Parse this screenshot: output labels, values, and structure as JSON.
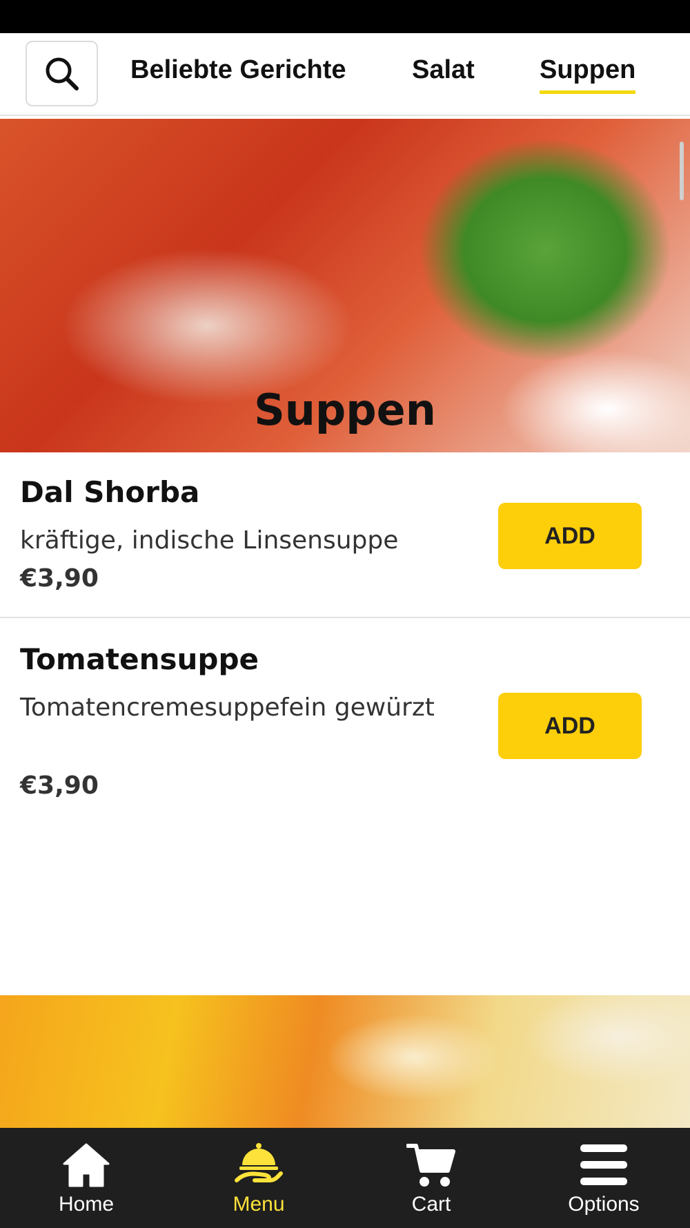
{
  "top_nav": {
    "search_icon": "search-icon",
    "categories": [
      {
        "label": "Beliebte Gerichte",
        "active": false
      },
      {
        "label": "Salat",
        "active": false
      },
      {
        "label": "Suppen",
        "active": true
      }
    ]
  },
  "section": {
    "title": "Suppen"
  },
  "items": [
    {
      "name": "Dal Shorba",
      "description": "kräftige, indische Linsensuppe",
      "price": "€3,90",
      "add_label": "ADD"
    },
    {
      "name": "Tomatensuppe",
      "description": "Tomatencremesuppefein gewürzt",
      "price": "€3,90",
      "add_label": "ADD"
    }
  ],
  "bottom_nav": {
    "items": [
      {
        "label": "Home",
        "icon": "home-icon",
        "active": false
      },
      {
        "label": "Menu",
        "icon": "food-tray-icon",
        "active": true
      },
      {
        "label": "Cart",
        "icon": "cart-icon",
        "active": false
      },
      {
        "label": "Options",
        "icon": "menu-bars-icon",
        "active": false
      }
    ]
  },
  "colors": {
    "accent": "#fdce0a",
    "active_nav": "#fce23a",
    "bottom_bar": "#1f1f1f",
    "status_bar": "#000000"
  }
}
